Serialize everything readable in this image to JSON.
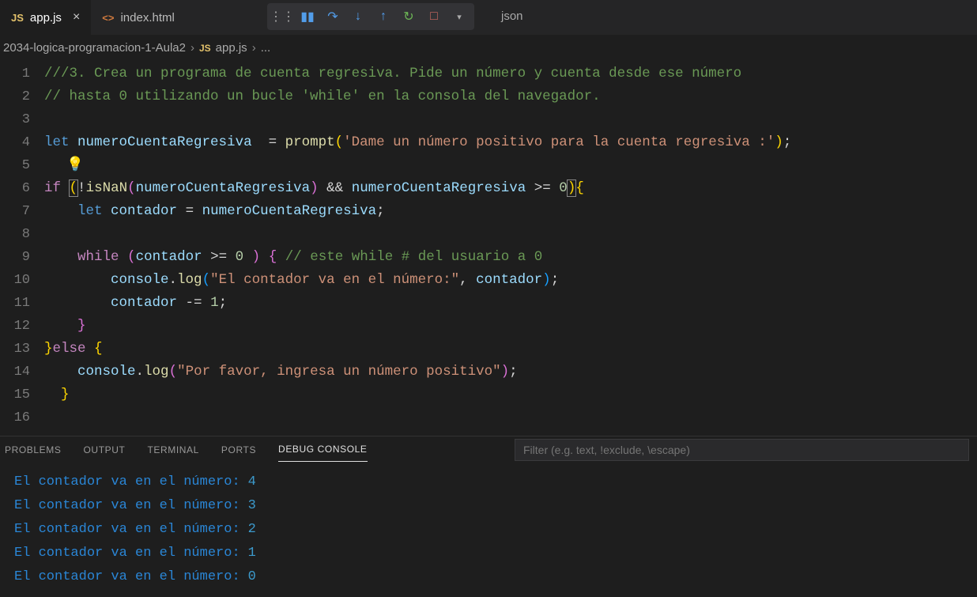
{
  "tabs": {
    "active": "app.js",
    "second": "index.html",
    "hidden": "json"
  },
  "breadcrumbs": {
    "folder": "2034-logica-programacion-1-Aula2",
    "file": "app.js",
    "trail": "..."
  },
  "icons": {
    "js": "JS",
    "html": "<>"
  },
  "code": {
    "c1": "///3. Crea un programa de cuenta regresiva. Pide un número y cuenta desde ese número ",
    "c2": "// hasta 0 utilizando un bucle 'while' en la consola del navegador. ",
    "let": "let",
    "var1": "numeroCuentaRegresiva",
    "prompt": "prompt",
    "str1": "'Dame un número positivo para la cuenta regresiva :'",
    "if": "if",
    "isnan": "isNaN",
    "amp": "&&",
    "gte": ">=",
    "zero": "0",
    "contador": "contador",
    "while": "while",
    "c3": "// este while # del usuario a 0",
    "clog": "console",
    "log": "log",
    "str2": "\"El contador va en el número:\"",
    "comma": ", ",
    "dec": "-= ",
    "one": "1",
    "else": "else",
    "str3": "\"Por favor, ingresa un número positivo\""
  },
  "panel": {
    "problems": "PROBLEMS",
    "output": "OUTPUT",
    "terminal": "TERMINAL",
    "ports": "PORTS",
    "debug": "DEBUG CONSOLE",
    "filter": "Filter (e.g. text, !exclude, \\escape)"
  },
  "console": {
    "msg": "El contador va en el número:",
    "vals": [
      "4",
      "3",
      "2",
      "1",
      "0"
    ]
  }
}
